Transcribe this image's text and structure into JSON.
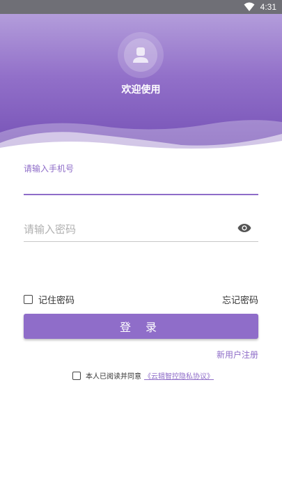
{
  "status_bar": {
    "time": "4:31",
    "icons": [
      "wifi-icon"
    ]
  },
  "header": {
    "welcome": "欢迎使用",
    "avatar_icon": "user-icon"
  },
  "form": {
    "phone_label": "请输入手机号",
    "phone_value": "",
    "password_placeholder": "请输入密码",
    "password_value": "",
    "toggle_icon": "eye-icon",
    "remember_label": "记住密码",
    "remember_checked": false,
    "forgot_label": "忘记密码",
    "login_label": "登 录",
    "register_label": "新用户注册",
    "agreement_prefix": "本人已阅读并同意",
    "agreement_link": "《云辑智控隐私协议》",
    "agreement_checked": false
  },
  "colors": {
    "accent": "#8e6cc8",
    "header_top": "#b39ddb",
    "header_bottom": "#7450b5"
  }
}
